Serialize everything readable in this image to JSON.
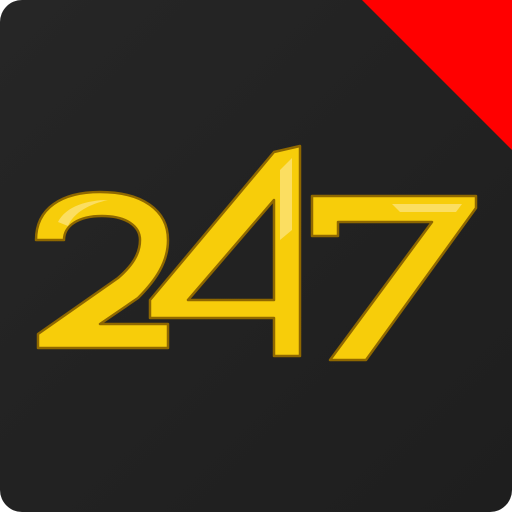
{
  "icon": {
    "logo_text": "247",
    "logo_name": "247-logo",
    "colors": {
      "background": "#262626",
      "background_edge": "#1e1e1e",
      "corner_ribbon": "#ff0000",
      "digit_fill": "#f7cd0a",
      "digit_highlight": "#fbe071",
      "digit_outline": "#8f6800"
    }
  }
}
